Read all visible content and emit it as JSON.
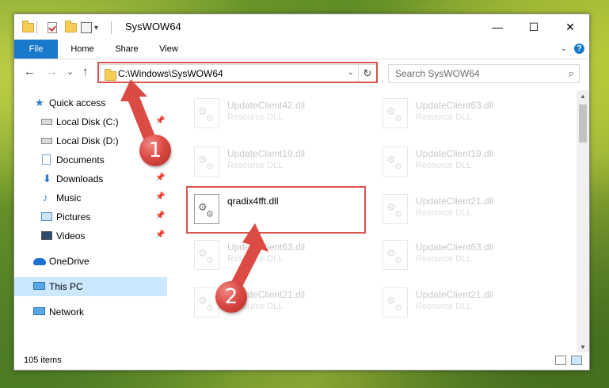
{
  "window": {
    "title": "SysWOW64"
  },
  "titlebar": {
    "minimize_glyph": "—",
    "maximize_glyph": "☐",
    "close_glyph": "✕",
    "qa_dropdown_glyph": "▾"
  },
  "ribbon": {
    "tabs": [
      {
        "label": "File"
      },
      {
        "label": "Home"
      },
      {
        "label": "Share"
      },
      {
        "label": "View"
      }
    ],
    "help_glyph": "?",
    "collapse_glyph": "⌄"
  },
  "navigation": {
    "back_glyph": "←",
    "forward_glyph": "→",
    "recent_glyph": "⌄",
    "up_glyph": "↑"
  },
  "address": {
    "path": "C:\\Windows\\SysWOW64",
    "dropdown_glyph": "⌄",
    "refresh_glyph": "↻"
  },
  "search": {
    "placeholder": "Search SysWOW64",
    "icon_glyph": "⌕"
  },
  "sidebar": {
    "pin_glyph": "📌",
    "items": [
      {
        "label": "Quick access",
        "icon": "star-icon"
      },
      {
        "label": "Local Disk (C:)",
        "icon": "disk-icon",
        "pinned": true
      },
      {
        "label": "Local Disk (D:)",
        "icon": "disk-icon",
        "pinned": false
      },
      {
        "label": "Documents",
        "icon": "documents-icon",
        "pinned": true
      },
      {
        "label": "Downloads",
        "icon": "downloads-icon",
        "pinned": true
      },
      {
        "label": "Music",
        "icon": "music-icon",
        "pinned": true
      },
      {
        "label": "Pictures",
        "icon": "pictures-icon",
        "pinned": true
      },
      {
        "label": "Videos",
        "icon": "videos-icon",
        "pinned": true
      },
      {
        "label": "OneDrive",
        "icon": "onedrive-icon"
      },
      {
        "label": "This PC",
        "icon": "this-pc-icon",
        "selected": true
      },
      {
        "label": "Network",
        "icon": "network-icon"
      }
    ]
  },
  "files": [
    {
      "name": "UpdateClient42.dll",
      "type": "Resource DLL",
      "faded": true
    },
    {
      "name": "UpdateClient63.dll",
      "type": "Resource DLL",
      "faded": true
    },
    {
      "name": "UpdateClient19.dll",
      "type": "Resource DLL",
      "faded": true
    },
    {
      "name": "UpdateClient19.dll",
      "type": "Resource DLL",
      "faded": true
    },
    {
      "name": "qradix4fft.dll",
      "type": "",
      "faded": false
    },
    {
      "name": "UpdateClient21.dll",
      "type": "Resource DLL",
      "faded": true
    },
    {
      "name": "UpdateClient63.dll",
      "type": "Resource DLL",
      "faded": true
    },
    {
      "name": "UpdateClient63.dll",
      "type": "Resource DLL",
      "faded": true
    },
    {
      "name": "UpdateClient21.dll",
      "type": "Resource DLL",
      "faded": true
    },
    {
      "name": "UpdateClient21.dll",
      "type": "Resource DLL",
      "faded": true
    }
  ],
  "status": {
    "item_count": "105 items"
  },
  "annotations": {
    "step1": "1",
    "step2": "2",
    "highlight_color": "#d9534f"
  },
  "colors": {
    "accent": "#1979ca",
    "selection": "#cce8ff"
  }
}
